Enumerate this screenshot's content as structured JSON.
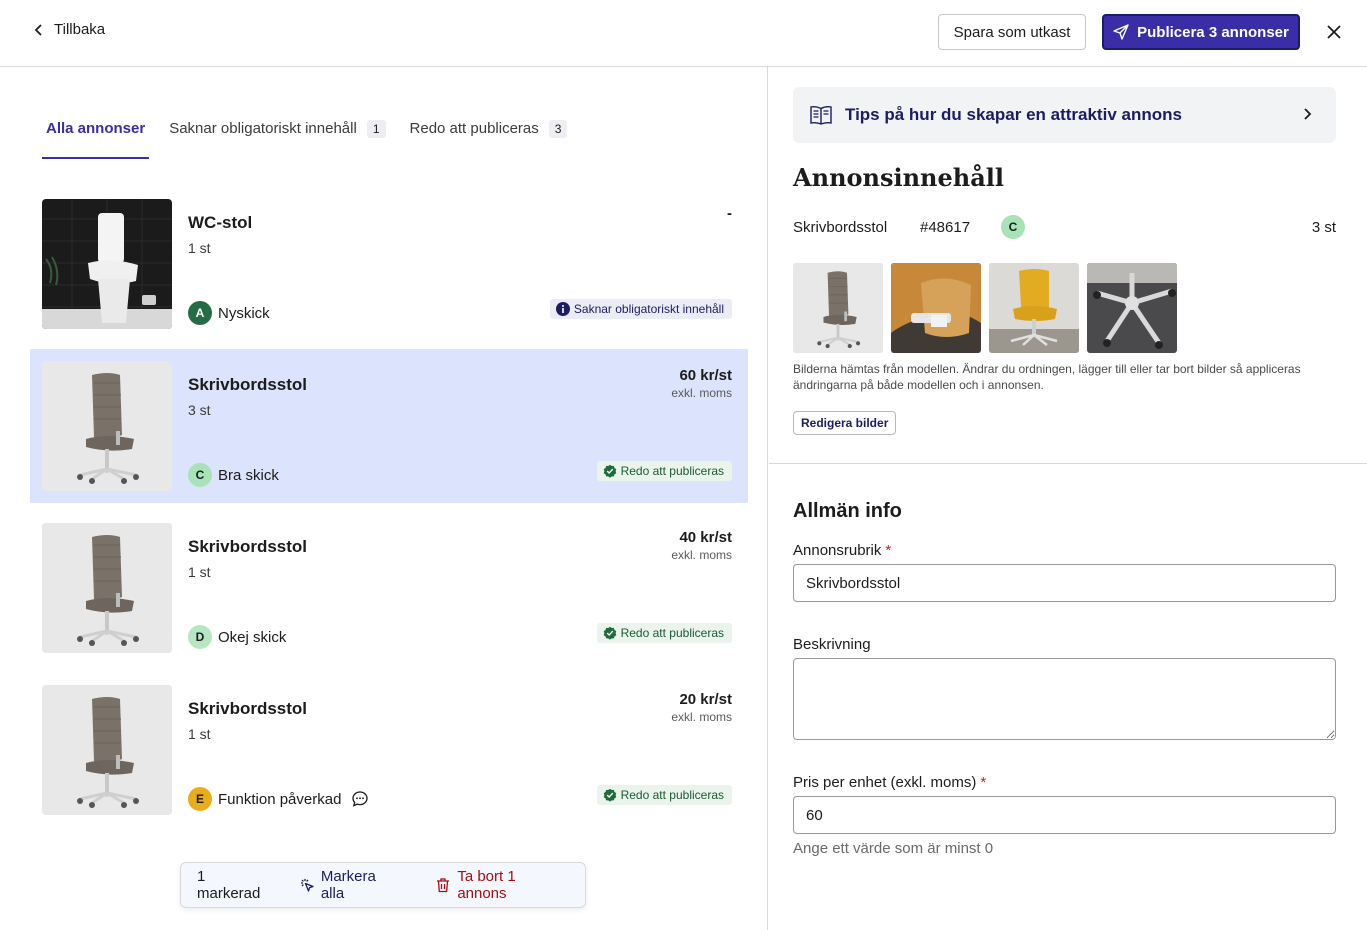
{
  "header": {
    "back_label": "Tillbaka",
    "draft_label": "Spara som utkast",
    "publish_label": "Publicera 3 annonser"
  },
  "tabs": [
    {
      "label": "Alla annonser",
      "count": ""
    },
    {
      "label": "Saknar obligatoriskt innehåll",
      "count": "1"
    },
    {
      "label": "Redo att publiceras",
      "count": "3"
    }
  ],
  "listings": [
    {
      "title": "WC-stol",
      "qty": "1 st",
      "price": "-",
      "vat": "",
      "grade": "A",
      "condition": "Nyskick",
      "status": "Saknar obligatoriskt innehåll"
    },
    {
      "title": "Skrivbordsstol",
      "qty": "3 st",
      "price": "60 kr/st",
      "vat": "exkl. moms",
      "grade": "C",
      "condition": "Bra skick",
      "status": "Redo att publiceras"
    },
    {
      "title": "Skrivbordsstol",
      "qty": "1 st",
      "price": "40 kr/st",
      "vat": "exkl. moms",
      "grade": "D",
      "condition": "Okej skick",
      "status": "Redo att publiceras"
    },
    {
      "title": "Skrivbordsstol",
      "qty": "1 st",
      "price": "20 kr/st",
      "vat": "exkl. moms",
      "grade": "E",
      "condition": "Funktion påverkad",
      "status": "Redo att publiceras"
    }
  ],
  "selection_bar": {
    "count_label": "1 markerad",
    "select_all_label": "Markera alla",
    "delete_label": "Ta bort 1 annons"
  },
  "detail": {
    "tips_label": "Tips på hur du skapar en attraktiv annons",
    "heading": "Annonsinnehåll",
    "name": "Skrivbordsstol",
    "id": "#48617",
    "grade": "C",
    "qty": "3 st",
    "images_note": "Bilderna hämtas från modellen. Ändrar du ordningen, lägger till eller tar bort bilder så appliceras ändringarna på både modellen och i annonsen.",
    "edit_images_label": "Redigera bilder",
    "general_heading": "Allmän info",
    "title_label": "Annonsrubrik",
    "title_value": "Skrivbordsstol",
    "description_label": "Beskrivning",
    "description_value": "",
    "price_label": "Pris per enhet (exkl. moms)",
    "price_value": "60",
    "price_hint": "Ange ett värde som är minst 0"
  },
  "colors": {
    "accent": "#3a2ea8",
    "selected_row": "#dce3fc",
    "required": "#c81e1e",
    "danger": "#a01010"
  }
}
